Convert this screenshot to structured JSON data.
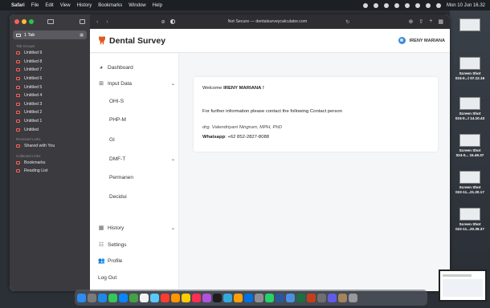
{
  "menubar": {
    "apple": "",
    "items": [
      "Safari",
      "File",
      "Edit",
      "View",
      "History",
      "Bookmarks",
      "Window",
      "Help"
    ],
    "clock": "Mon 10 Jun 16.32"
  },
  "desktop": {
    "screenshots": [
      {
        "title": "Screen Shot",
        "sub": "024-0...t 07.12.16"
      },
      {
        "title": "Screen Shot",
        "sub": "024-0...t 14.10.43"
      },
      {
        "title": "Screen Shot",
        "sub": "024-0... 15.49.37"
      },
      {
        "title": "Screen Shot",
        "sub": "022-11...21.20.17"
      },
      {
        "title": "Screen Shot",
        "sub": "022-11...20.39.37"
      }
    ]
  },
  "safari_sidebar": {
    "tab_label": "1 Tab",
    "tab_groups_header": "Tab Groups",
    "groups": [
      "Untitled 9",
      "Untitled 8",
      "Untitled 7",
      "Untitled 6",
      "Untitled 5",
      "Untitled 4",
      "Untitled 3",
      "Untitled 2",
      "Untitled 1",
      "Untitled"
    ],
    "received_header": "Received Links",
    "shared": "Shared with You",
    "collected_header": "Collected Links",
    "bookmarks": "Bookmarks",
    "reading_list": "Reading List"
  },
  "toolbar": {
    "url": "Not Secure — dentalsurveycalculator.com"
  },
  "site": {
    "brand": "Dental Survey",
    "user_name": "IRENY MARIANA",
    "brand_color": "#e05a1e"
  },
  "nav": {
    "dashboard": "Dashboard",
    "input_data": "Input Data",
    "sub_items": [
      "OHI-S",
      "PHP-M",
      "GI",
      "DMF-T",
      "Permanen",
      "Decidui"
    ],
    "history": "History",
    "settings": "Settings",
    "profile": "Profile",
    "logout": "Log Out"
  },
  "card": {
    "welcome_prefix": "Welcome ",
    "welcome_name": "IRENY MARIANA !",
    "info": "For further information please contact the following Contact person",
    "contact_name": "drg. Valendriyani Ningrum, MPH, PhD",
    "whatsapp_label": "Whatsapp",
    "whatsapp_value": ": +62 852-2827-8088"
  }
}
